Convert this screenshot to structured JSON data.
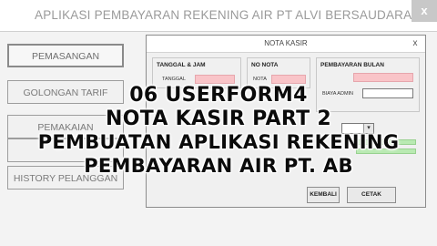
{
  "main_window": {
    "title": "APLIKASI PEMBAYARAN REKENING AIR PT ALVI BERSAUDARA",
    "close_label": "x"
  },
  "nav": {
    "buttons": [
      {
        "label": "PEMASANGAN"
      },
      {
        "label": "GOLONGAN TARIF"
      },
      {
        "label": "PEMAKAIAN"
      },
      {
        "label": ""
      },
      {
        "label": "HISTORY PELANGGAN"
      }
    ]
  },
  "dialog": {
    "title": "NOTA KASIR",
    "close_label": "x",
    "tanggal_group_label": "TANGGAL & JAM",
    "tanggal_label": "TANGGAL",
    "nota_group_label": "NO NOTA",
    "nota_label": "NOTA",
    "bulan_group_label": "PEMBAYARAN BULAN",
    "biaya_admin_label": "BIAYA ADMIN",
    "combo_arrow": "▾",
    "buttons": {
      "hidden_label": "KEMBALI",
      "cetak_label": "CETAK"
    }
  },
  "overlay": {
    "line1": "06 USERFORM4",
    "line2": "NOTA KASIR PART 2",
    "line3": "PEMBUATAN APLIKASI REKENING",
    "line4": "PEMBAYARAN AIR PT. AB"
  }
}
